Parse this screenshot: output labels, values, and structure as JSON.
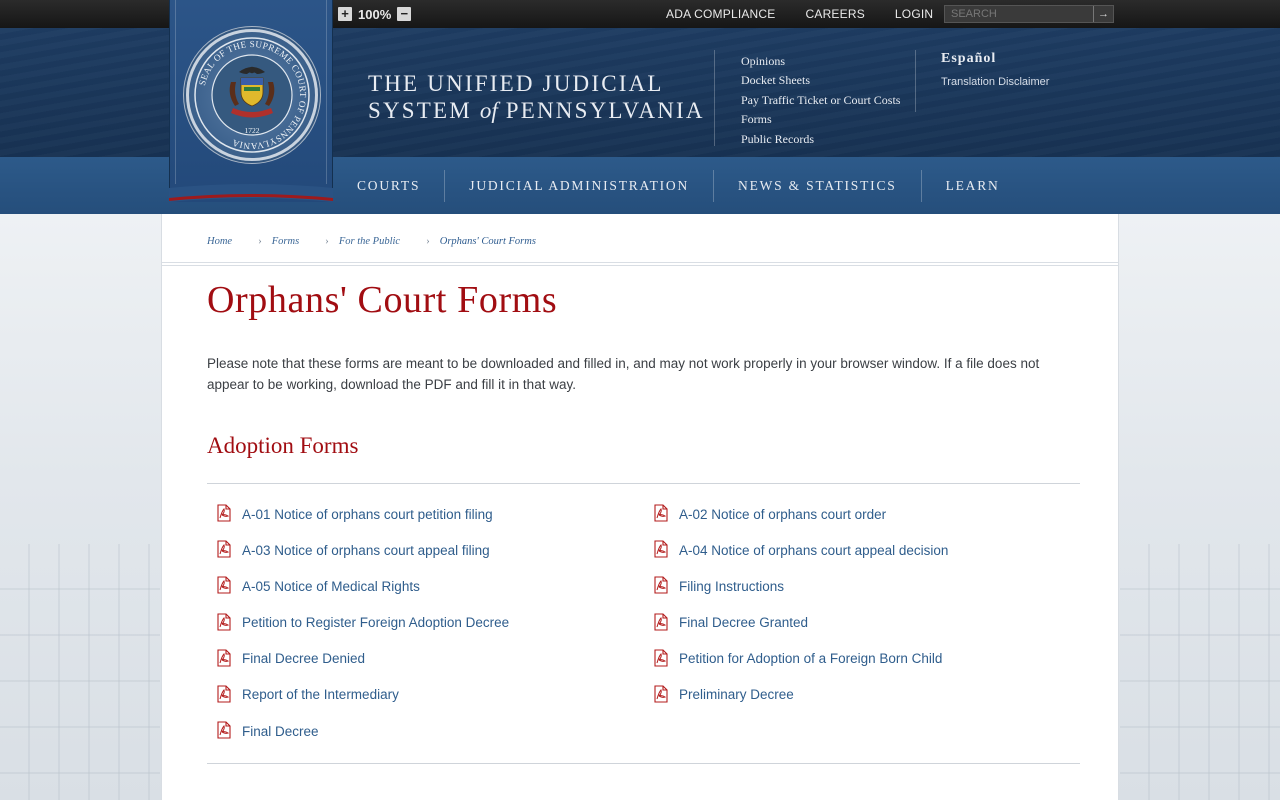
{
  "topbar": {
    "zoom_in": "+",
    "zoom_level": "100%",
    "zoom_out": "−",
    "links": [
      "ADA COMPLIANCE",
      "CAREERS",
      "LOGIN"
    ],
    "search_placeholder": "SEARCH",
    "search_go": "→"
  },
  "header": {
    "title_line1": "THE UNIFIED JUDICIAL",
    "title_line2a": "SYSTEM ",
    "title_of": "of",
    "title_line2b": " PENNSYLVANIA",
    "quick_links": [
      "Opinions",
      "Docket Sheets",
      "Pay Traffic Ticket or Court Costs",
      "Forms",
      "Public Records"
    ],
    "language": "Español",
    "translation_disclaimer": "Translation Disclaimer"
  },
  "seal": {
    "top_text": "SEAL OF THE SUPREME COURT OF PENNSYLVANIA",
    "year": "1722"
  },
  "nav": {
    "items": [
      "COURTS",
      "JUDICIAL ADMINISTRATION",
      "NEWS & STATISTICS",
      "LEARN"
    ]
  },
  "breadcrumb": {
    "items": [
      "Home",
      "Forms",
      "For the Public"
    ],
    "current": "Orphans' Court Forms"
  },
  "page": {
    "title": "Orphans' Court Forms",
    "note": "Please note that these forms are meant to be downloaded and filled in, and may not work properly in your browser window. If a file does not appear to be working, download the PDF and fill it in that way.",
    "section_title": "Adoption Forms"
  },
  "forms": [
    "A-01 Notice of orphans court petition filing",
    "A-02 Notice of orphans court order",
    "A-03 Notice of orphans court appeal filing",
    "A-04 Notice of orphans court appeal decision",
    "A-05 Notice of Medical Rights",
    "Filing Instructions",
    "Petition to Register Foreign Adoption Decree",
    "Final Decree Granted",
    "Final Decree Denied",
    "Petition for Adoption of a Foreign Born Child",
    "Report of the Intermediary",
    "Preliminary Decree",
    "Final Decree"
  ],
  "colors": {
    "title_red": "#a10d12",
    "link_blue": "#2f5d8c",
    "header_navy": "#1e3c62",
    "nav_blue": "#2d5a8a"
  }
}
